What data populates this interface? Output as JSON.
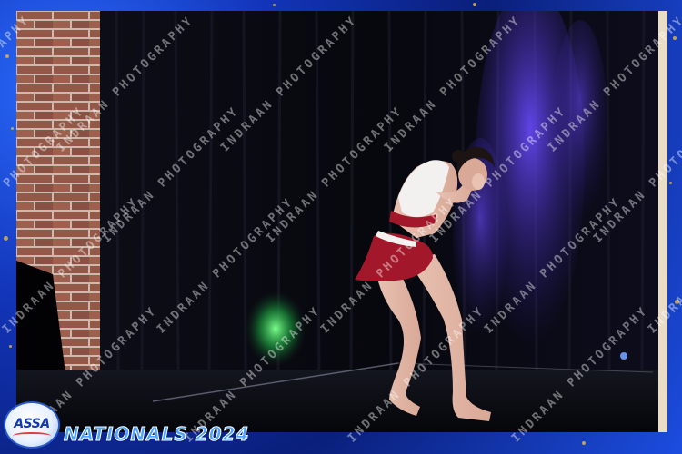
{
  "event": {
    "title": "NATIONALS 2024",
    "logo_text": "ASSA"
  },
  "watermark": {
    "text": "INDRAAN PHOTOGRAPHY"
  },
  "colors": {
    "frame_blue": "#1234b8",
    "frame_gold": "#d9b24a",
    "curtain": "#0a0b14",
    "stage_light_purple": "#5a3cff",
    "stage_light_green": "#33ff66",
    "costume_red": "#a3172a",
    "brick": "#8b4a39"
  }
}
